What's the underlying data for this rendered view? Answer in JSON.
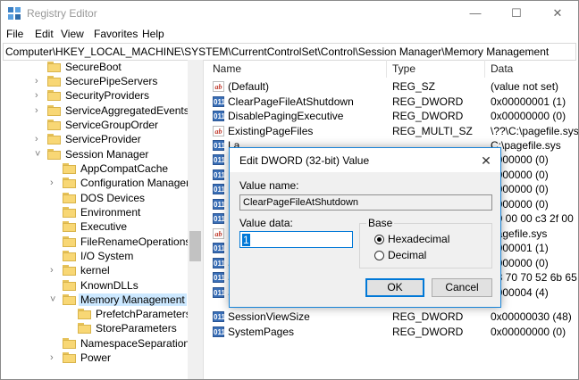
{
  "window": {
    "title": "Registry Editor",
    "minimize_glyph": "—",
    "maximize_glyph": "☐",
    "close_glyph": "✕"
  },
  "menu": [
    "File",
    "Edit",
    "View",
    "Favorites",
    "Help"
  ],
  "address": "Computer\\HKEY_LOCAL_MACHINE\\SYSTEM\\CurrentControlSet\\Control\\Session Manager\\Memory Management",
  "tree": [
    {
      "label": "SecureBoot",
      "chevron": ""
    },
    {
      "label": "SecurePipeServers",
      "chevron": "›"
    },
    {
      "label": "SecurityProviders",
      "chevron": "›"
    },
    {
      "label": "ServiceAggregatedEvents",
      "chevron": "›"
    },
    {
      "label": "ServiceGroupOrder",
      "chevron": ""
    },
    {
      "label": "ServiceProvider",
      "chevron": "›"
    },
    {
      "label": "Session Manager",
      "chevron": "˅"
    },
    {
      "label": "AppCompatCache",
      "chevron": ""
    },
    {
      "label": "Configuration Manager",
      "chevron": "›"
    },
    {
      "label": "DOS Devices",
      "chevron": ""
    },
    {
      "label": "Environment",
      "chevron": ""
    },
    {
      "label": "Executive",
      "chevron": ""
    },
    {
      "label": "FileRenameOperations",
      "chevron": ""
    },
    {
      "label": "I/O System",
      "chevron": ""
    },
    {
      "label": "kernel",
      "chevron": "›"
    },
    {
      "label": "KnownDLLs",
      "chevron": ""
    },
    {
      "label": "Memory Management",
      "chevron": "˅"
    },
    {
      "label": "PrefetchParameters",
      "chevron": ""
    },
    {
      "label": "StoreParameters",
      "chevron": ""
    },
    {
      "label": "NamespaceSeparation",
      "chevron": ""
    },
    {
      "label": "Power",
      "chevron": "›"
    }
  ],
  "list": {
    "headers": {
      "name": "Name",
      "type": "Type",
      "data": "Data"
    },
    "rows": [
      {
        "name": "(Default)",
        "type": "REG_SZ",
        "data": "(value not set)",
        "icon": "ab"
      },
      {
        "name": "ClearPageFileAtShutdown",
        "type": "REG_DWORD",
        "data": "0x00000001 (1)",
        "icon": "011"
      },
      {
        "name": "DisablePagingExecutive",
        "type": "REG_DWORD",
        "data": "0x00000000 (0)",
        "icon": "011"
      },
      {
        "name": "ExistingPageFiles",
        "type": "REG_MULTI_SZ",
        "data": "\\??\\C:\\pagefile.sys",
        "icon": "ab"
      },
      {
        "name": "La",
        "type": "",
        "data": "C:\\pagefile.sys",
        "icon": "011"
      },
      {
        "name": "N",
        "type": "",
        "data": "0000000 (0)",
        "icon": "011"
      },
      {
        "name": "N",
        "type": "",
        "data": "0000000 (0)",
        "icon": "011"
      },
      {
        "name": "P",
        "type": "",
        "data": "0000000 (0)",
        "icon": "011"
      },
      {
        "name": "P",
        "type": "",
        "data": "0000000 (0)",
        "icon": "011"
      },
      {
        "name": "P",
        "type": "",
        "data": "00 00 00 c3 2f 00",
        "icon": "011"
      },
      {
        "name": "P",
        "type": "",
        "data": "pagefile.sys",
        "icon": "ab"
      },
      {
        "name": "P",
        "type": "",
        "data": "0000001 (1)",
        "icon": "011"
      },
      {
        "name": "Se",
        "type": "",
        "data": "0000000 (0)",
        "icon": "011"
      },
      {
        "name": "Se",
        "type": "",
        "data": "73 70 70 52 6b 65",
        "icon": "011"
      },
      {
        "name": "Se",
        "type": "",
        "data": "0000004 (4)",
        "icon": "011"
      },
      {
        "name": "SessionViewSize",
        "type": "REG_DWORD",
        "data": "0x00000030 (48)",
        "icon": "011"
      },
      {
        "name": "SystemPages",
        "type": "REG_DWORD",
        "data": "0x00000000 (0)",
        "icon": "011"
      }
    ]
  },
  "dialog": {
    "title": "Edit DWORD (32-bit) Value",
    "close_glyph": "✕",
    "value_name_label": "Value name:",
    "value_name": "ClearPageFileAtShutdown",
    "value_data_label": "Value data:",
    "value_data": "1",
    "base_label": "Base",
    "hex_label": "Hexadecimal",
    "dec_label": "Decimal",
    "ok_label": "OK",
    "cancel_label": "Cancel"
  }
}
